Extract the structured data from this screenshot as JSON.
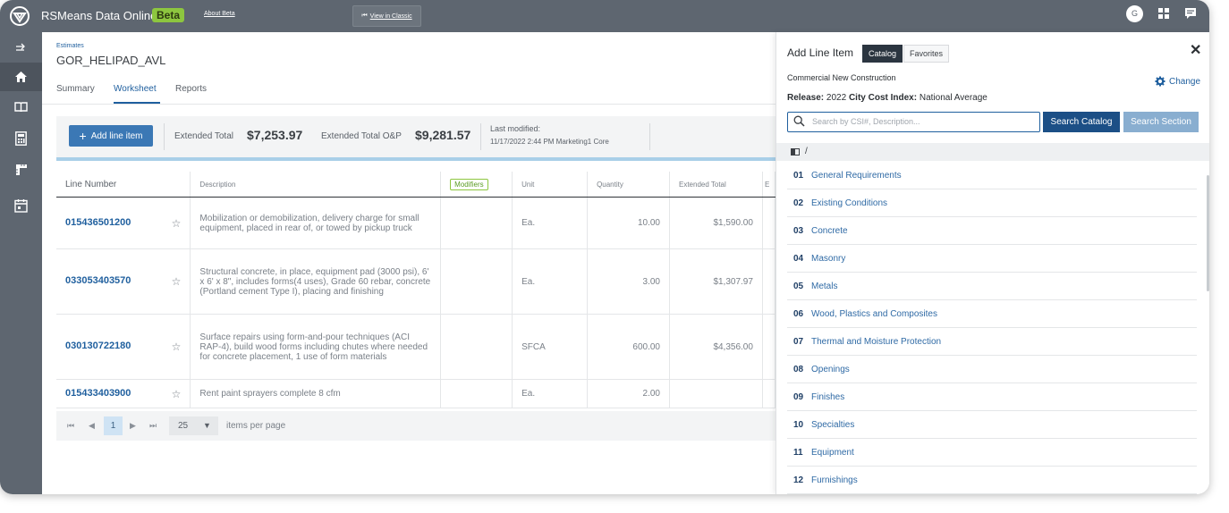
{
  "header": {
    "app_title": "RSMeans Data Online",
    "beta_badge": "Beta",
    "about_link": "About Beta",
    "classic_link": "View in Classic",
    "user_initial": "G"
  },
  "sidebar": {
    "items": [
      {
        "icon": "collapse-arrows-icon"
      },
      {
        "icon": "home-icon",
        "active": true
      },
      {
        "icon": "book-icon"
      },
      {
        "icon": "calculator-icon"
      },
      {
        "icon": "measure-icon"
      },
      {
        "icon": "calendar-icon"
      }
    ]
  },
  "estimate": {
    "breadcrumb": "Estimates",
    "name": "GOR_HELIPAD_AVL",
    "tabs": [
      "Summary",
      "Worksheet",
      "Reports"
    ],
    "active_tab": "Worksheet"
  },
  "toolbar": {
    "add_label": "Add line item",
    "ext_total_label": "Extended Total",
    "ext_total_value": "$7,253.97",
    "ext_op_label": "Extended Total O&P",
    "ext_op_value": "$9,281.57",
    "last_modified_label": "Last modified:",
    "last_modified_value": "11/17/2022 2:44 PM Marketing1 Core"
  },
  "table": {
    "headers": {
      "line_number": "Line Number",
      "description": "Description",
      "modifiers": "Modifiers",
      "unit": "Unit",
      "quantity": "Quantity",
      "extended_total": "Extended Total",
      "partial": "E"
    },
    "rows": [
      {
        "line": "015436501200",
        "desc": "Mobilization or demobilization, delivery charge for small equipment, placed in rear of, or towed by pickup truck",
        "unit": "Ea.",
        "qty": "10.00",
        "total": "$1,590.00"
      },
      {
        "line": "033053403570",
        "desc": "Structural concrete, in place, equipment pad (3000 psi), 6' x 6' x 8\", includes forms(4 uses), Grade 60 rebar, concrete (Portland cement Type I), placing and finishing",
        "unit": "Ea.",
        "qty": "3.00",
        "total": "$1,307.97"
      },
      {
        "line": "030130722180",
        "desc": "Surface repairs using form-and-pour techniques (ACI RAP-4), build wood forms including chutes where needed for concrete placement, 1 use of form materials",
        "unit": "SFCA",
        "qty": "600.00",
        "total": "$4,356.00"
      },
      {
        "line": "015433403900",
        "desc": "Rent paint sprayers complete 8 cfm",
        "unit": "Ea.",
        "qty": "2.00",
        "total": ""
      }
    ]
  },
  "pager": {
    "current_page": "1",
    "page_size": "25",
    "items_per_page": "items per page"
  },
  "panel": {
    "title": "Add Line Item",
    "tab_catalog": "Catalog",
    "tab_favorites": "Favorites",
    "category": "Commercial New Construction",
    "release_label": "Release:",
    "release_value": "2022",
    "cci_label": "City Cost Index:",
    "cci_value": "National Average",
    "change_label": "Change",
    "search_placeholder": "Search by CSI#, Description...",
    "search_catalog": "Search Catalog",
    "search_section": "Search Section",
    "path": "/",
    "divisions": [
      {
        "code": "01",
        "name": "General Requirements"
      },
      {
        "code": "02",
        "name": "Existing Conditions"
      },
      {
        "code": "03",
        "name": "Concrete"
      },
      {
        "code": "04",
        "name": "Masonry"
      },
      {
        "code": "05",
        "name": "Metals"
      },
      {
        "code": "06",
        "name": "Wood, Plastics and Composites"
      },
      {
        "code": "07",
        "name": "Thermal and Moisture Protection"
      },
      {
        "code": "08",
        "name": "Openings"
      },
      {
        "code": "09",
        "name": "Finishes"
      },
      {
        "code": "10",
        "name": "Specialties"
      },
      {
        "code": "11",
        "name": "Equipment"
      },
      {
        "code": "12",
        "name": "Furnishings"
      }
    ]
  },
  "colors": {
    "topbar": "#5e6670",
    "accent": "#1f5f9e",
    "beta": "#8dc63f"
  }
}
